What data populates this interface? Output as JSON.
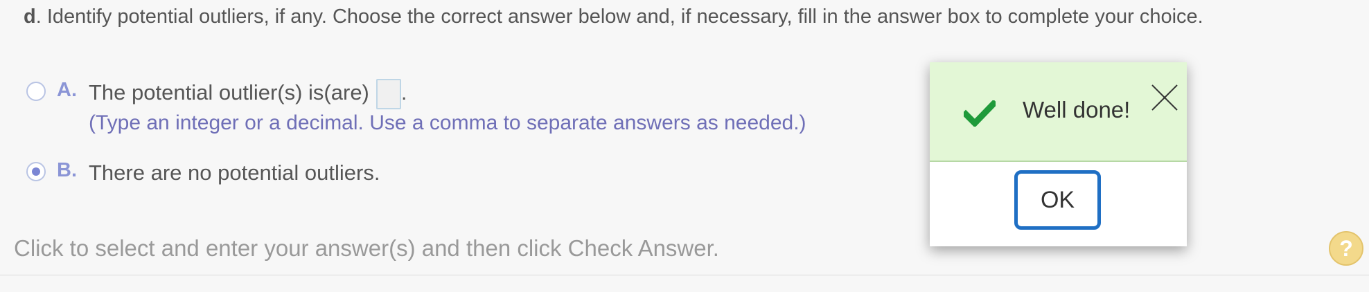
{
  "question": {
    "part_label": "d",
    "text": ". Identify potential outliers, if any. Choose the correct answer below and, if necessary, fill in the answer box to complete your choice."
  },
  "choices": [
    {
      "letter": "A.",
      "text": "The potential outlier(s) is(are)",
      "suffix": ".",
      "answer_value": "",
      "hint": "(Type an integer or a decimal. Use a comma to separate answers as needed.)",
      "selected": false
    },
    {
      "letter": "B.",
      "text": "There are no potential outliers.",
      "selected": true
    }
  ],
  "footer": {
    "instruction": "Click to select and enter your answer(s) and then click Check Answer.",
    "help_label": "?"
  },
  "dialog": {
    "message": "Well done!",
    "ok_label": "OK",
    "icons": {
      "check": "check-icon",
      "close": "close-icon"
    },
    "colors": {
      "success_bg": "#e3f7d6",
      "check_green": "#1f9a3a",
      "ok_border": "#1f6fc4"
    }
  }
}
